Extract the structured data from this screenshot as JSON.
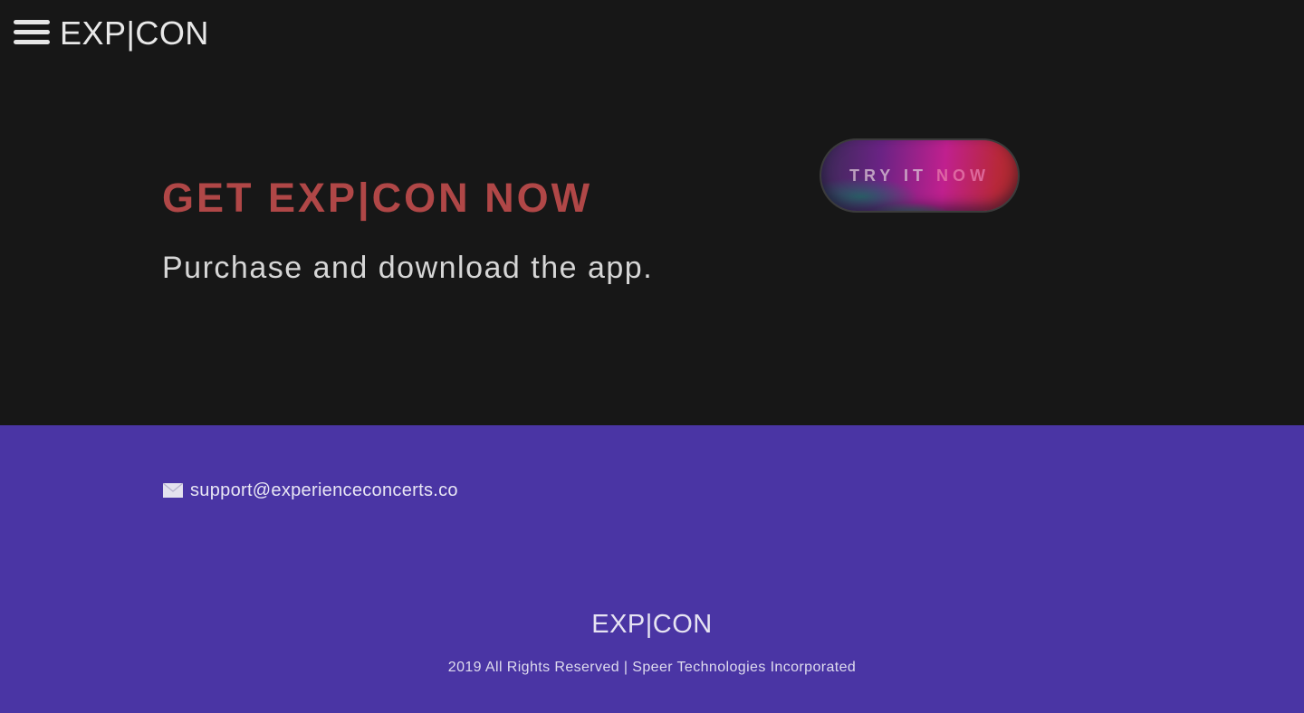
{
  "header": {
    "menu_icon": "hamburger-menu-icon",
    "logo": "EXP|CON"
  },
  "hero": {
    "headline": "GET EXP|CON NOW",
    "subline": "Purchase and download the app.",
    "cta_part1": "TRY IT ",
    "cta_part2": "NOW"
  },
  "footer": {
    "contact_icon": "envelope-icon",
    "email": "support@experienceconcerts.co",
    "logo": "EXP|CON",
    "copyright": "2019 All Rights Reserved | Speer Technologies Incorporated"
  },
  "colors": {
    "hero_bg": "#171717",
    "headline": "#b04747",
    "footer_bg": "#4a35a4"
  }
}
